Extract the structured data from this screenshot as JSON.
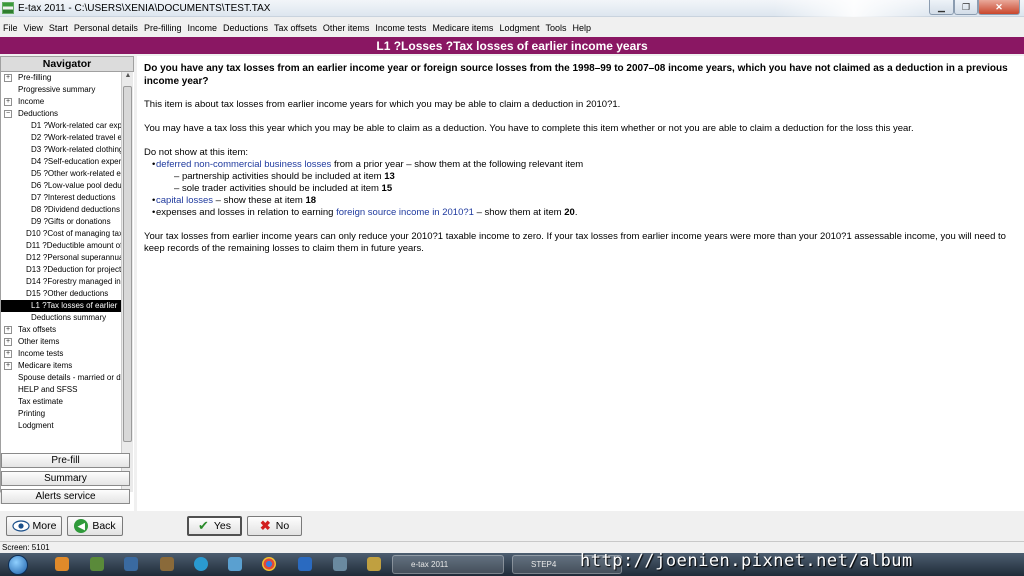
{
  "window": {
    "title": "E-tax 2011 - C:\\USERS\\XENIA\\DOCUMENTS\\TEST.TAX",
    "min_symbol": "▁",
    "max_symbol": "❐",
    "close_symbol": "✕"
  },
  "menu": [
    "File",
    "View",
    "Start",
    "Personal details",
    "Pre-filling",
    "Income",
    "Deductions",
    "Tax offsets",
    "Other items",
    "Income tests",
    "Medicare items",
    "Lodgment",
    "Tools",
    "Help"
  ],
  "header": {
    "title": "L1 ?Losses ?Tax losses of earlier income years"
  },
  "navigator": {
    "title": "Navigator",
    "items": [
      {
        "label": "Pre-filling",
        "indent": 0,
        "expander": "+"
      },
      {
        "label": "Progressive summary",
        "indent": 0,
        "expander": ""
      },
      {
        "label": "Income",
        "indent": 0,
        "expander": "+"
      },
      {
        "label": "Deductions",
        "indent": 0,
        "expander": "−"
      },
      {
        "label": "D1 ?Work-related car exp",
        "indent": 2,
        "expander": ""
      },
      {
        "label": "D2 ?Work-related travel e",
        "indent": 2,
        "expander": ""
      },
      {
        "label": "D3 ?Work-related clothing",
        "indent": 2,
        "expander": ""
      },
      {
        "label": "D4 ?Self-education exper",
        "indent": 2,
        "expander": ""
      },
      {
        "label": "D5 ?Other work-related e",
        "indent": 2,
        "expander": ""
      },
      {
        "label": "D6 ?Low-value pool dedu",
        "indent": 2,
        "expander": ""
      },
      {
        "label": "D7 ?Interest deductions",
        "indent": 2,
        "expander": ""
      },
      {
        "label": "D8 ?Dividend deductions",
        "indent": 2,
        "expander": ""
      },
      {
        "label": "D9 ?Gifts or donations",
        "indent": 2,
        "expander": ""
      },
      {
        "label": "D10 ?Cost of managing tax",
        "indent": 1,
        "expander": ""
      },
      {
        "label": "D11 ?Deductible amount of",
        "indent": 1,
        "expander": ""
      },
      {
        "label": "D12 ?Personal superannua",
        "indent": 1,
        "expander": ""
      },
      {
        "label": "D13 ?Deduction for project",
        "indent": 1,
        "expander": ""
      },
      {
        "label": "D14 ?Forestry managed in",
        "indent": 1,
        "expander": ""
      },
      {
        "label": "D15 ?Other deductions",
        "indent": 1,
        "expander": ""
      },
      {
        "label": "L1 ?Tax losses of earlier",
        "indent": 2,
        "expander": "",
        "selected": true
      },
      {
        "label": "Deductions summary",
        "indent": 2,
        "expander": ""
      },
      {
        "label": "Tax offsets",
        "indent": 0,
        "expander": "+"
      },
      {
        "label": "Other items",
        "indent": 0,
        "expander": "+"
      },
      {
        "label": "Income tests",
        "indent": 0,
        "expander": "+"
      },
      {
        "label": "Medicare items",
        "indent": 0,
        "expander": "+"
      },
      {
        "label": "Spouse details - married or d",
        "indent": 0,
        "expander": ""
      },
      {
        "label": "HELP and SFSS",
        "indent": 0,
        "expander": ""
      },
      {
        "label": "Tax estimate",
        "indent": 0,
        "expander": ""
      },
      {
        "label": "Printing",
        "indent": 0,
        "expander": ""
      },
      {
        "label": "Lodgment",
        "indent": 0,
        "expander": ""
      }
    ],
    "buttons": {
      "prefill": "Pre-fill",
      "summary": "Summary",
      "alerts": "Alerts service"
    },
    "hscroll_grip": "|||"
  },
  "content": {
    "question": "Do you have any tax losses from an earlier income year or foreign source losses from the 1998–99 to 2007–08 income years, which you have not claimed as a deduction in a previous income year?",
    "para1": "This item is about tax losses from earlier income years for which you may be able to claim a deduction in 2010?1.",
    "para2": "You may have a tax loss this year which you may be able to claim as a deduction. You have to complete this item whether or not you are able to claim a deduction for the loss this year.",
    "do_not_show": "Do not show at this item:",
    "b1_link": "deferred non-commercial business losses",
    "b1_text": " from a prior year – show them at the following relevant item",
    "sub1_text": "partnership activities should be included at item ",
    "sub1_item": "13",
    "sub2_text": "sole trader activities should be included at item ",
    "sub2_item": "15",
    "b2_link": "capital losses",
    "b2_text": " – show these at item ",
    "b2_item": "18",
    "b3_text": "expenses and losses in relation to earning ",
    "b3_link": "foreign source income in 2010?1",
    "b3_text2": " – show them at item ",
    "b3_item": "20",
    "b3_end": ".",
    "para3": "Your tax losses from earlier income years can only reduce your 2010?1 taxable income to zero. If your tax losses from earlier income years were more than your 2010?1 assessable income, you will need to keep records of the remaining losses to claim them in future years."
  },
  "bottom": {
    "more": "More",
    "back": "Back",
    "yes": "Yes",
    "no": "No"
  },
  "status": {
    "text": "Screen: 5101"
  },
  "taskbar": {
    "task1": "e-tax 2011",
    "task2": "STEP4"
  },
  "watermark": "http://joenien.pixnet.net/album",
  "colors": {
    "header": "#8a1763",
    "link": "#1f3a9e"
  }
}
